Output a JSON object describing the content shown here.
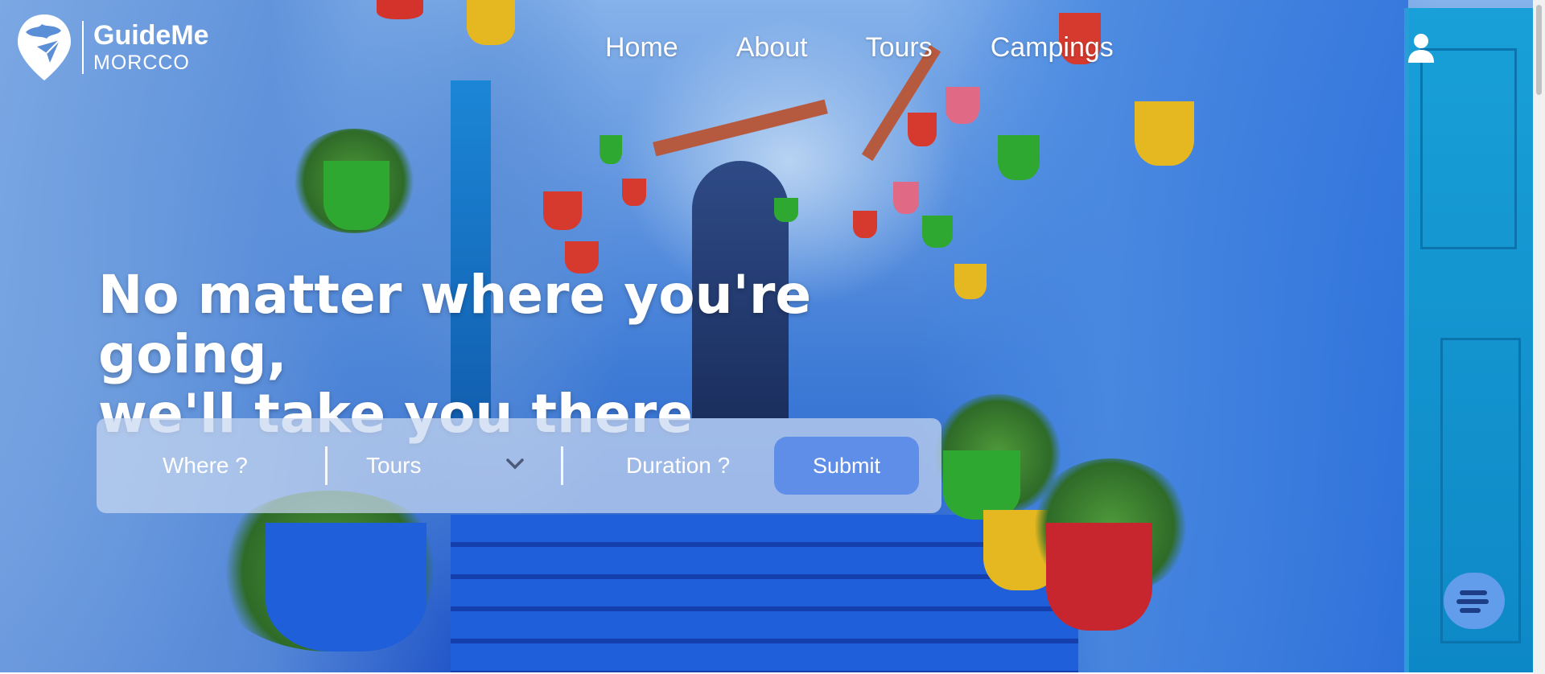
{
  "brand": {
    "name": "GuideMe",
    "tagline": "MORCCO",
    "logo_icon": "map-pin-plane-icon"
  },
  "nav": {
    "items": [
      {
        "label": "Home"
      },
      {
        "label": "About"
      },
      {
        "label": "Tours"
      },
      {
        "label": "Campings"
      }
    ],
    "user_icon": "user-icon"
  },
  "hero": {
    "headline_line1": "No matter where you're going,",
    "headline_line2": "we'll take you there"
  },
  "search": {
    "where_placeholder": "Where ?",
    "type_selected": "Tours",
    "type_icon": "chevron-down-icon",
    "duration_placeholder": "Duration ?",
    "submit_label": "Submit"
  },
  "chat": {
    "icon": "chat-icon"
  },
  "colors": {
    "primary": "#5e8ee8",
    "text_light": "#ffffff",
    "search_bg": "#c8d7f0"
  }
}
